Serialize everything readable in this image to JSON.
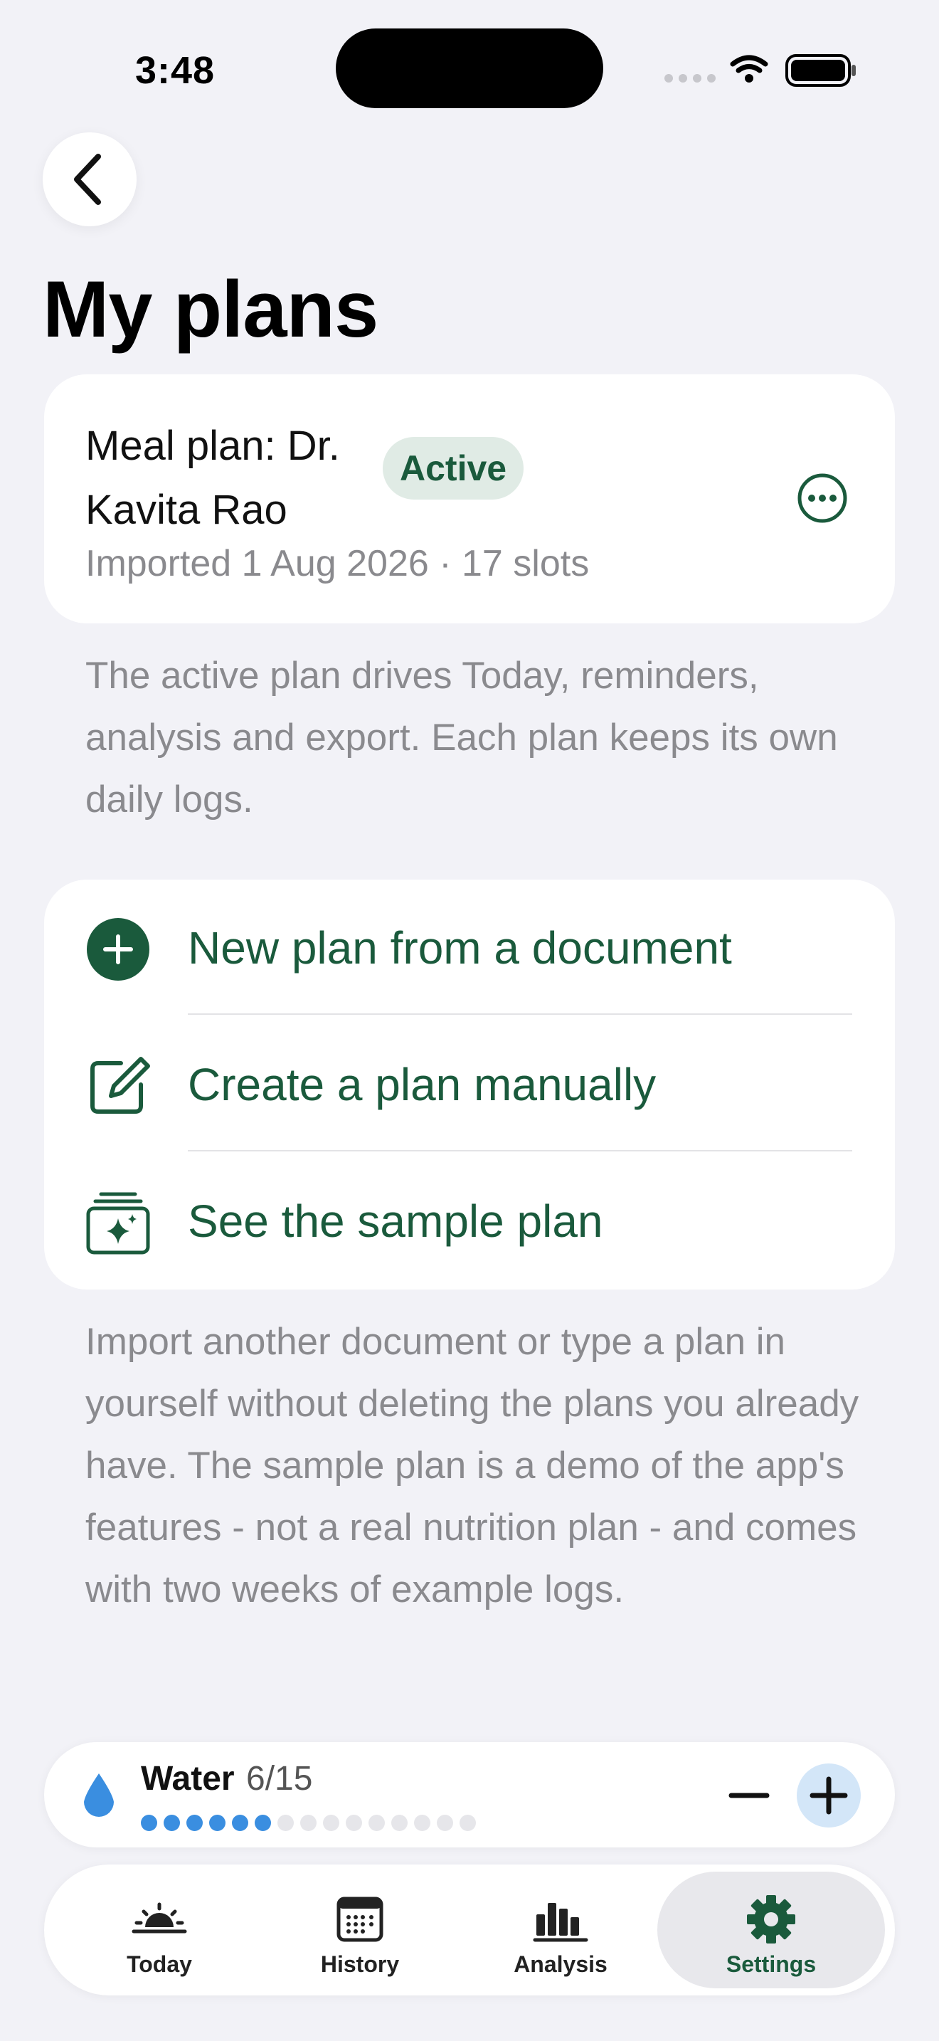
{
  "status_bar": {
    "time": "3:48"
  },
  "page": {
    "title": "My plans"
  },
  "active_plan": {
    "name": "Meal plan: Dr. Kavita Rao",
    "badge": "Active",
    "meta": "Imported 1 Aug 2026 · 17 slots"
  },
  "active_note": "The active plan drives Today, reminders, analysis and export. Each plan keeps its own daily logs.",
  "actions": [
    {
      "label": "New plan from a document",
      "icon": "plus-circle-icon"
    },
    {
      "label": "Create a plan manually",
      "icon": "square-pencil-icon"
    },
    {
      "label": "See the sample plan",
      "icon": "sparkle-stack-icon"
    }
  ],
  "actions_note": "Import another document or type a plan in yourself without deleting the plans you already have. The sample plan is a demo of the app's features - not a real nutrition plan - and comes with two weeks of example logs.",
  "water": {
    "label": "Water",
    "count": "6/15",
    "consumed": 6,
    "goal": 15
  },
  "tabs": [
    {
      "label": "Today",
      "icon": "sunrise-icon",
      "active": false
    },
    {
      "label": "History",
      "icon": "calendar-icon",
      "active": false
    },
    {
      "label": "Analysis",
      "icon": "bar-chart-icon",
      "active": false
    },
    {
      "label": "Settings",
      "icon": "gear-icon",
      "active": true
    }
  ],
  "colors": {
    "accent": "#1a5a3c",
    "water": "#3a8ee0",
    "background": "#f2f2f7"
  }
}
